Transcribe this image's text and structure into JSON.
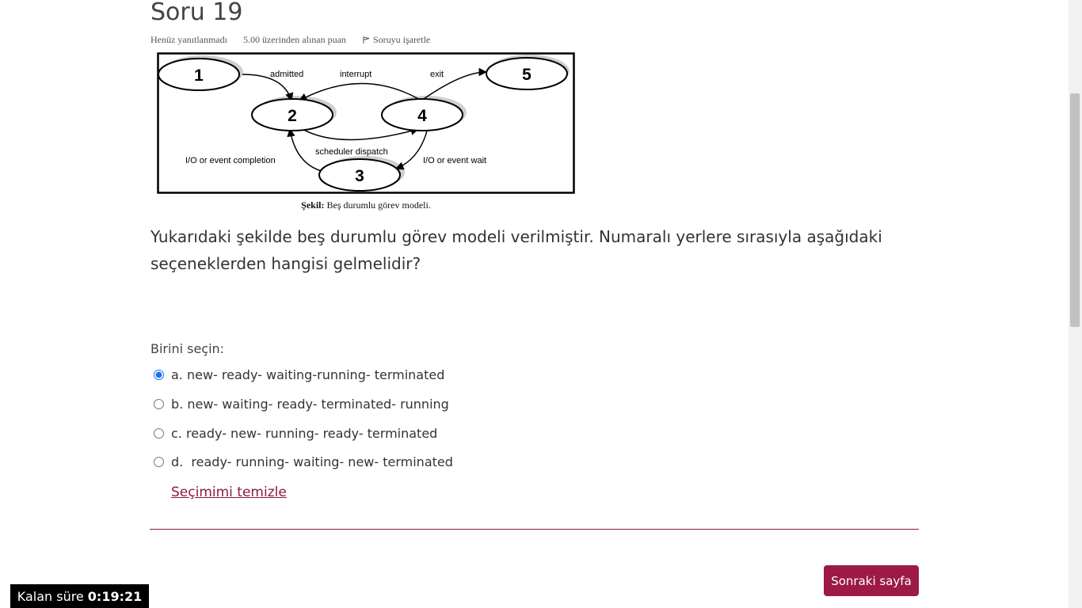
{
  "question": {
    "title": "Soru 19",
    "status": "Henüz yanıtlanmadı",
    "points": "5.00 üzerinden alınan puan",
    "flag_label": "Soruyu işaretle",
    "text": "Yukarıdaki şekilde beş durumlu görev modeli verilmiştir. Numaralı yerlere sırasıyla aşağıdaki seçeneklerden hangisi gelmelidir?",
    "prompt": "Birini seçin:",
    "clear_label": "Seçimimi temizle"
  },
  "figure": {
    "nodes": [
      "1",
      "2",
      "3",
      "4",
      "5"
    ],
    "labels": {
      "admitted": "admitted",
      "interrupt": "interrupt",
      "exit": "exit",
      "scheduler": "scheduler dispatch",
      "io_completion": "I/O or event completion",
      "io_wait": "I/O or event wait"
    },
    "caption_bold": "Şekil:",
    "caption_text": " Beş durumlu görev modeli."
  },
  "options": [
    {
      "label": "a. new- ready- waiting-running- terminated",
      "selected": true
    },
    {
      "label": "b. new- waiting- ready- terminated- running",
      "selected": false
    },
    {
      "label": "c. ready- new- running- ready- terminated",
      "selected": false
    },
    {
      "label": "d.  ready- running- waiting- new- terminated",
      "selected": false
    }
  ],
  "navigation": {
    "next_label": "Sonraki sayfa"
  },
  "timer": {
    "label": "Kalan süre",
    "value": "0:19:21"
  },
  "colors": {
    "accent": "#9c1a45",
    "link": "#8b1a3a",
    "radio": "#1a73e8"
  }
}
